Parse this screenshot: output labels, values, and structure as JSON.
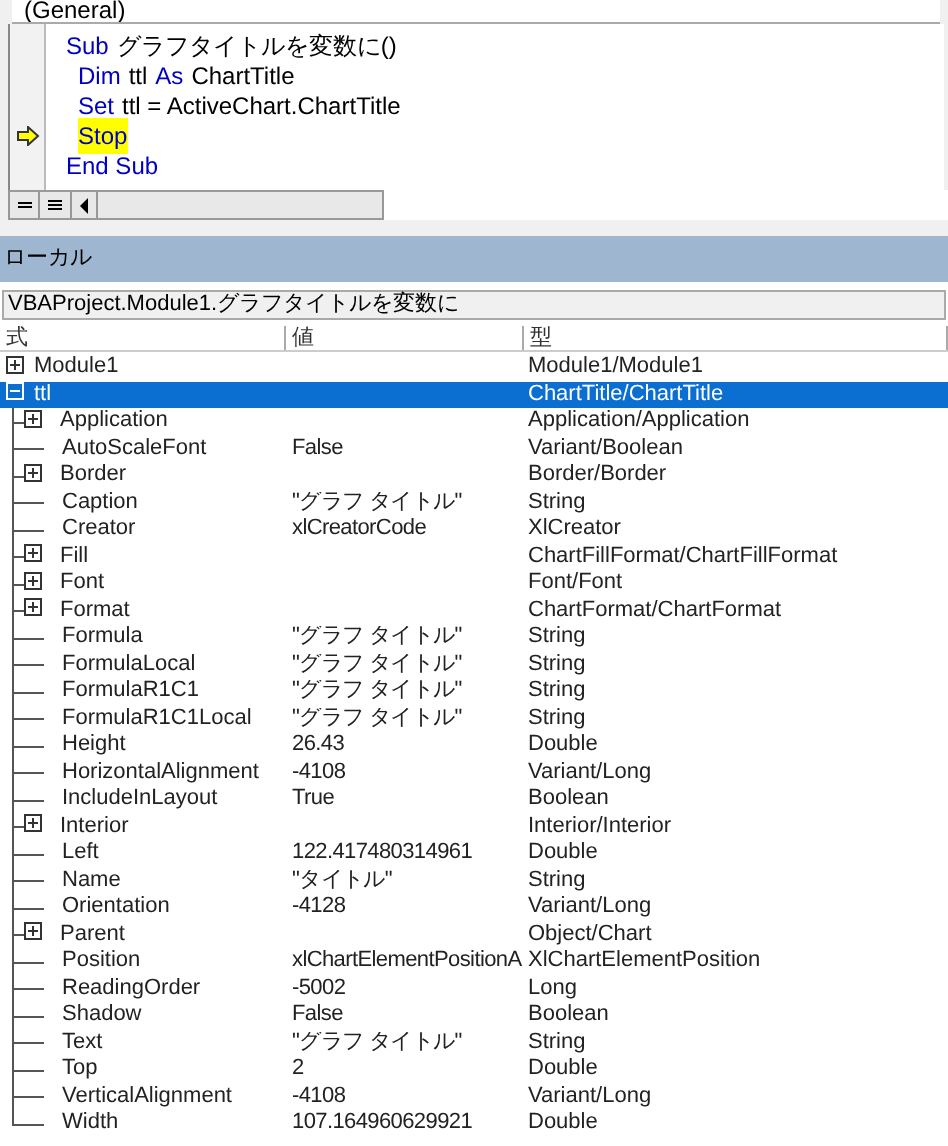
{
  "object_box": {
    "value": "(General)"
  },
  "code": [
    {
      "indented": false,
      "current": false,
      "tokens": [
        {
          "text": "Sub",
          "kind": "keyword"
        },
        {
          "text": "グラフタイトルを変数に()",
          "kind": "plain"
        }
      ]
    },
    {
      "indented": true,
      "current": false,
      "tokens": [
        {
          "text": "Dim",
          "kind": "keyword"
        },
        {
          "text": "ttl",
          "kind": "plain"
        },
        {
          "text": "As",
          "kind": "keyword"
        },
        {
          "text": "ChartTitle",
          "kind": "plain"
        }
      ]
    },
    {
      "indented": true,
      "current": false,
      "tokens": [
        {
          "text": "Set",
          "kind": "keyword"
        },
        {
          "text": "ttl = ActiveChart.ChartTitle",
          "kind": "plain"
        }
      ]
    },
    {
      "indented": true,
      "current": true,
      "tokens": [
        {
          "text": "Stop",
          "kind": "keyword"
        }
      ]
    },
    {
      "indented": false,
      "current": false,
      "tokens": [
        {
          "text": "End Sub",
          "kind": "keyword"
        }
      ]
    }
  ],
  "locals": {
    "title": "ローカル",
    "context": "VBAProject.Module1.グラフタイトルを変数に",
    "columns": [
      "式",
      "値",
      "型"
    ],
    "rows": [
      {
        "name": "Module1",
        "value": "",
        "type": "Module1/Module1",
        "expanded": false,
        "selected": false
      },
      {
        "name": "ttl",
        "value": "",
        "type": "ChartTitle/ChartTitle",
        "expanded": true,
        "selected": true,
        "children": [
          {
            "name": "Application",
            "type": "Application/Application",
            "expanded": false
          },
          {
            "name": "AutoScaleFont",
            "value": "False",
            "type": "Variant/Boolean"
          },
          {
            "name": "Border",
            "type": "Border/Border",
            "expanded": false
          },
          {
            "name": "Caption",
            "value": "\"グラフ タイトル\"",
            "type": "String"
          },
          {
            "name": "Creator",
            "value": "xlCreatorCode",
            "type": "XlCreator"
          },
          {
            "name": "Fill",
            "type": "ChartFillFormat/ChartFillFormat",
            "expanded": false
          },
          {
            "name": "Font",
            "type": "Font/Font",
            "expanded": false
          },
          {
            "name": "Format",
            "type": "ChartFormat/ChartFormat",
            "expanded": false
          },
          {
            "name": "Formula",
            "value": "\"グラフ タイトル\"",
            "type": "String"
          },
          {
            "name": "FormulaLocal",
            "value": "\"グラフ タイトル\"",
            "type": "String"
          },
          {
            "name": "FormulaR1C1",
            "value": "\"グラフ タイトル\"",
            "type": "String"
          },
          {
            "name": "FormulaR1C1Local",
            "value": "\"グラフ タイトル\"",
            "type": "String"
          },
          {
            "name": "Height",
            "value": "26.43",
            "type": "Double"
          },
          {
            "name": "HorizontalAlignment",
            "value": "-4108",
            "type": "Variant/Long"
          },
          {
            "name": "IncludeInLayout",
            "value": "True",
            "type": "Boolean"
          },
          {
            "name": "Interior",
            "type": "Interior/Interior",
            "expanded": false
          },
          {
            "name": "Left",
            "value": "122.417480314961",
            "type": "Double"
          },
          {
            "name": "Name",
            "value": "\"タイトル\"",
            "type": "String"
          },
          {
            "name": "Orientation",
            "value": "-4128",
            "type": "Variant/Long"
          },
          {
            "name": "Parent",
            "type": "Object/Chart",
            "expanded": false
          },
          {
            "name": "Position",
            "value": "xlChartElementPositionA",
            "type": "XlChartElementPosition"
          },
          {
            "name": "ReadingOrder",
            "value": "-5002",
            "type": "Long"
          },
          {
            "name": "Shadow",
            "value": "False",
            "type": "Boolean"
          },
          {
            "name": "Text",
            "value": "\"グラフ タイトル\"",
            "type": "String"
          },
          {
            "name": "Top",
            "value": "2",
            "type": "Double"
          },
          {
            "name": "VerticalAlignment",
            "value": "-4108",
            "type": "Variant/Long"
          },
          {
            "name": "Width",
            "value": "107.164960629921",
            "type": "Double"
          }
        ]
      }
    ]
  }
}
